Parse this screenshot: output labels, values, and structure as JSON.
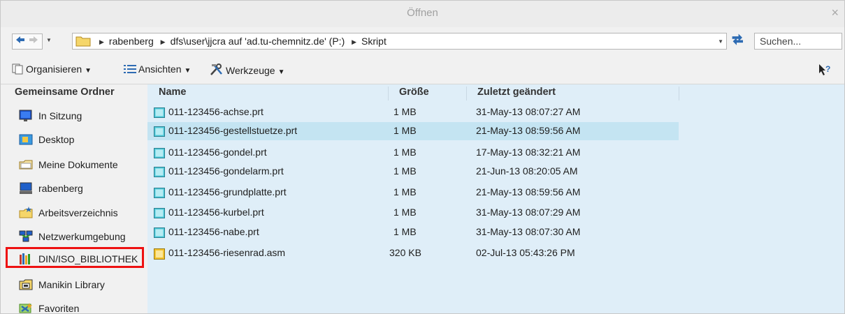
{
  "window": {
    "title": "Öffnen",
    "close_glyph": "×"
  },
  "address": {
    "crumbs": [
      "rabenberg",
      "dfs\\user\\jjcra auf 'ad.tu-chemnitz.de' (P:)",
      "Skript"
    ],
    "search_placeholder": "Suchen..."
  },
  "toolbar": {
    "organize_label": "Organisieren",
    "views_label": "Ansichten",
    "tools_label": "Werkzeuge"
  },
  "sidebar": {
    "header": "Gemeinsame Ordner",
    "items": [
      {
        "label": "In Sitzung",
        "icon": "monitor-icon"
      },
      {
        "label": "Desktop",
        "icon": "desktop-icon"
      },
      {
        "label": "Meine Dokumente",
        "icon": "documents-folder-icon"
      },
      {
        "label": "rabenberg",
        "icon": "computer-icon"
      },
      {
        "label": "Arbeitsverzeichnis",
        "icon": "working-directory-icon"
      },
      {
        "label": "Netzwerkumgebung",
        "icon": "network-icon"
      },
      {
        "label": "DIN/ISO_BIBLIOTHEK",
        "icon": "library-icon"
      },
      {
        "label": "Manikin Library",
        "icon": "manikin-library-icon"
      },
      {
        "label": "Favoriten",
        "icon": "favorites-icon"
      }
    ],
    "highlighted_item": "DIN/ISO_BIBLIOTHEK",
    "highlight_color": "#ee1111"
  },
  "files": {
    "columns": {
      "name": "Name",
      "size": "Größe",
      "modified": "Zuletzt geändert"
    },
    "rows": [
      {
        "name": "011-123456-achse.prt",
        "size": "1 MB",
        "modified": "31-May-13 08:07:27 AM",
        "type": "part"
      },
      {
        "name": "011-123456-gestellstuetze.prt",
        "size": "1 MB",
        "modified": "21-May-13 08:59:56 AM",
        "type": "part",
        "selected": true
      },
      {
        "name": "011-123456-gondel.prt",
        "size": "1 MB",
        "modified": "17-May-13 08:32:21 AM",
        "type": "part"
      },
      {
        "name": "011-123456-gondelarm.prt",
        "size": "1 MB",
        "modified": "21-Jun-13 08:20:05 AM",
        "type": "part"
      },
      {
        "name": "011-123456-grundplatte.prt",
        "size": "1 MB",
        "modified": "21-May-13 08:59:56 AM",
        "type": "part"
      },
      {
        "name": "011-123456-kurbel.prt",
        "size": "1 MB",
        "modified": "31-May-13 08:07:29 AM",
        "type": "part"
      },
      {
        "name": "011-123456-nabe.prt",
        "size": "1 MB",
        "modified": "31-May-13 08:07:30 AM",
        "type": "part"
      },
      {
        "name": "011-123456-riesenrad.asm",
        "size": "320 KB",
        "modified": "02-Jul-13 05:43:26 PM",
        "type": "assembly"
      }
    ]
  },
  "colors": {
    "list_background": "#dfeef8",
    "selected_row": "#c4e4f2",
    "part_icon": "#4cc8d8",
    "assembly_icon": "#f2c230"
  }
}
